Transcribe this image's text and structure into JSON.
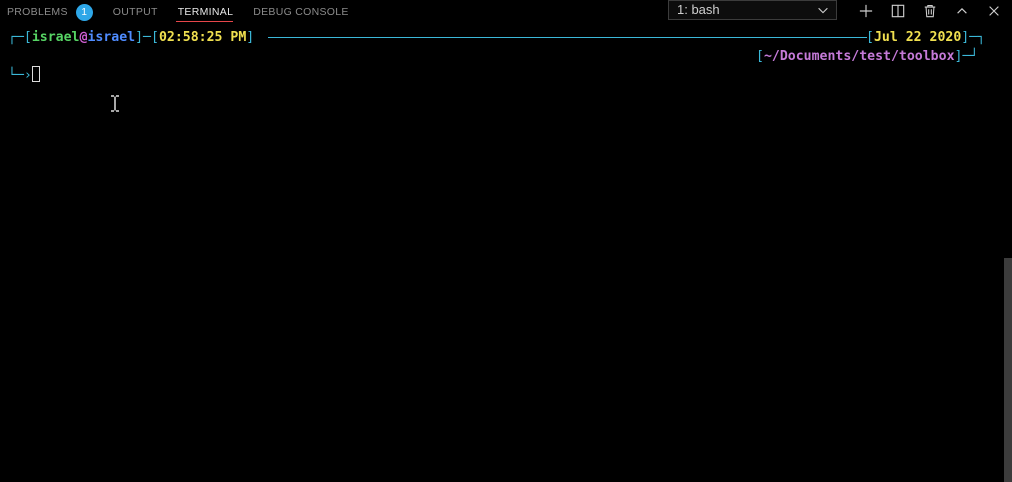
{
  "tabs": {
    "problems": "PROBLEMS",
    "problems_count": "1",
    "output": "OUTPUT",
    "terminal": "TERMINAL",
    "debug": "DEBUG CONSOLE"
  },
  "terminal_select": {
    "value": "1: bash"
  },
  "actions": [
    "plus-icon",
    "split-icon",
    "trash-icon",
    "chevron-up-icon",
    "close-icon"
  ],
  "prompt": {
    "corner_top": "┌─",
    "open1": "[",
    "user": "israel",
    "at": "@",
    "host": "israel",
    "close1": "]",
    "dash1": "─",
    "open2": "[",
    "time": "02:58:25 PM",
    "close2": "]",
    "open3": "[",
    "date": "Jul 22 2020",
    "close3": "]",
    "corner_tr": "─┐",
    "open4": "[",
    "path": "~/Documents/test/toolbox",
    "close4": "]",
    "corner_br": "─┘",
    "corner_bl": "└─",
    "arrow": "›"
  },
  "colors": {
    "accent_cyan": "#3bb8d8",
    "time_yellow": "#f0e050",
    "path_magenta": "#d66ad6",
    "active_tab_underline": "#e7464a",
    "badge": "#2ea7e8"
  }
}
